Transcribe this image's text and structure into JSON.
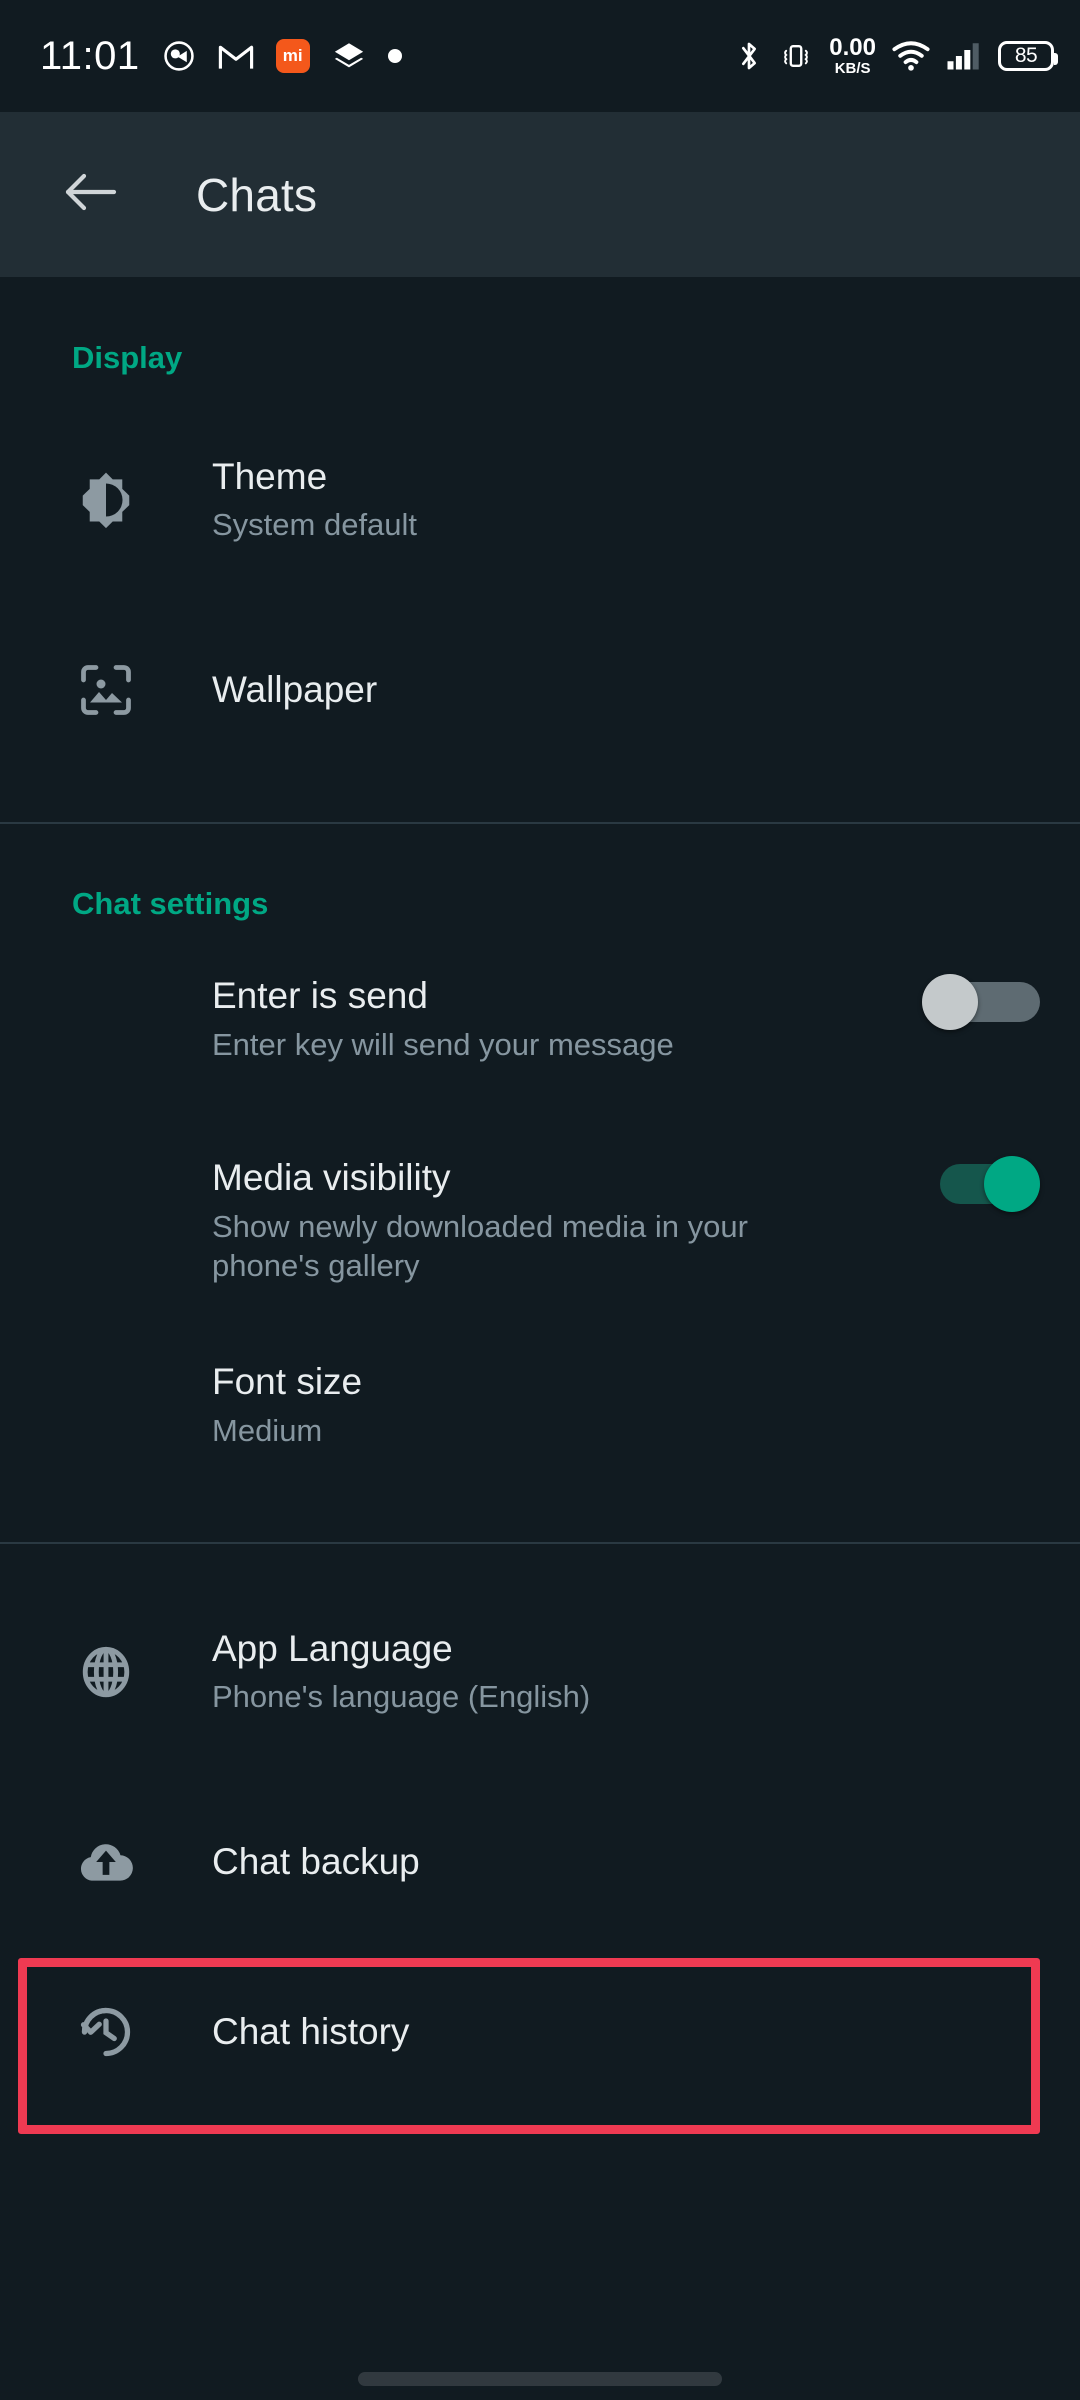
{
  "status_bar": {
    "time": "11:01",
    "left_icons": [
      "camera-app-icon",
      "gmail-icon",
      "mi-app-icon",
      "layers-icon",
      "dot-icon"
    ],
    "mi_label": "mi",
    "net_speed_value": "0.00",
    "net_speed_unit": "KB/S",
    "right_icons": [
      "bluetooth-icon",
      "vibrate-icon",
      "wifi-icon",
      "cellular-signal-icon"
    ],
    "battery_level": "85"
  },
  "app_bar": {
    "back_icon": "arrow-left-icon",
    "title": "Chats"
  },
  "accent_color": "#00a884",
  "highlight_color": "#ef3a52",
  "sections": [
    {
      "header": "Display",
      "rows": [
        {
          "icon": "brightness-theme-icon",
          "title": "Theme",
          "subtitle": "System default"
        },
        {
          "icon": "wallpaper-image-icon",
          "title": "Wallpaper",
          "subtitle": ""
        }
      ]
    },
    {
      "header": "Chat settings",
      "rows": [
        {
          "icon": "",
          "title": "Enter is send",
          "subtitle": "Enter key will send your message",
          "toggle": "off"
        },
        {
          "icon": "",
          "title": "Media visibility",
          "subtitle": "Show newly downloaded media in your phone's gallery",
          "toggle": "on"
        },
        {
          "icon": "",
          "title": "Font size",
          "subtitle": "Medium"
        }
      ]
    },
    {
      "header": "",
      "rows": [
        {
          "icon": "globe-icon",
          "title": "App Language",
          "subtitle": "Phone's language (English)"
        },
        {
          "icon": "cloud-upload-icon",
          "title": "Chat backup",
          "subtitle": "",
          "highlighted": true
        },
        {
          "icon": "history-clock-icon",
          "title": "Chat history",
          "subtitle": ""
        }
      ]
    }
  ]
}
